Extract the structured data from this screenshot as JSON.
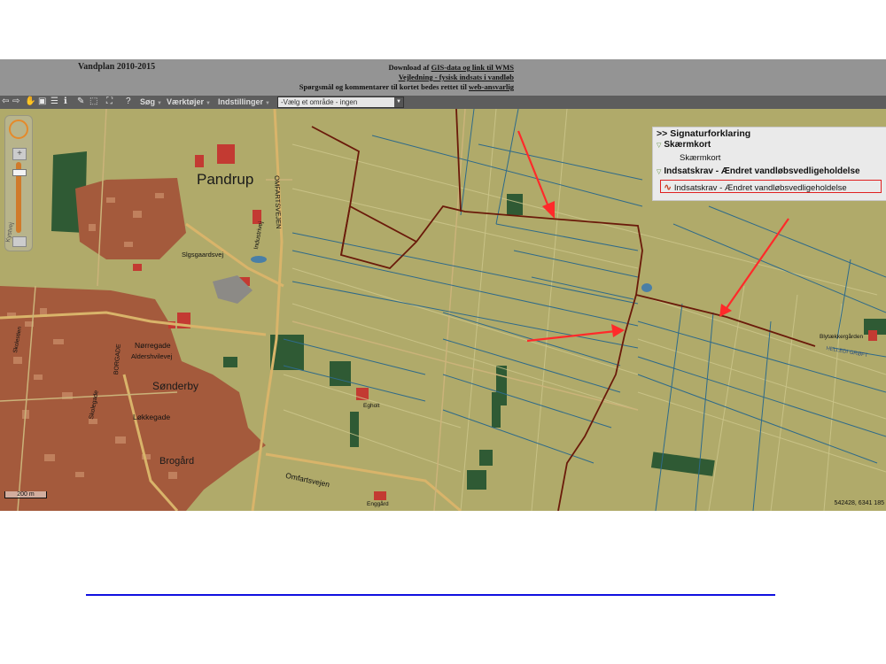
{
  "header": {
    "title": "Vandplan 2010-2015",
    "download_prefix": "Download af ",
    "download_link1": "GIS-data og link til WMS",
    "vejledning": "Vejledning - fysisk indsats i vandløb",
    "contact_prefix": "Spørgsmål og kommentarer til kortet bedes rettet til ",
    "contact_link": "web-ansvarlig"
  },
  "toolbar": {
    "menus": [
      {
        "label": "Søg"
      },
      {
        "label": "Værktøjer"
      },
      {
        "label": "Indstillinger"
      }
    ],
    "area_select_value": "-Vælg et område - ingen",
    "icons": [
      "back-icon",
      "forward-icon",
      "pan-hand-icon",
      "zoom-box-icon",
      "list-icon",
      "info-icon",
      "draw-icon",
      "select-icon",
      "measure-icon",
      "help-icon"
    ]
  },
  "legend": {
    "heading": "Signaturforklaring",
    "group1": "Skærmkort",
    "group1_item": "Skærmkort",
    "group2": "Indsatskrav - Ændret vandløbsvedligeholdelse",
    "group2_item": "Indsatskrav - Ændret vandløbsvedligeholdelse"
  },
  "map": {
    "town_main": "Pandrup",
    "town_2": "Sønderby",
    "town_3": "Brogård",
    "roads": {
      "omfartsvejen": "OMFARTSVEJEN",
      "omfartsvejen2": "Omfartsvejen",
      "norregade": "Nørregade",
      "aldershvilevej": "Aldershvilevej",
      "lokkegade": "Løkkegade",
      "slagsgaardsvej": "Slgsgaardsvej",
      "industrivej": "Industrivej",
      "borgade": "BORGADE",
      "skolegade": "Skolegade",
      "kystvej": "Kystvej",
      "egholt": "Egholt",
      "enggard": "Enggård",
      "blytaekkergarden": "Blytækkergården",
      "helledi": "HELLEDI GRØFT",
      "skolestien": "Skolestien"
    },
    "scale_label": "200 m",
    "coords": "542428, 6341 185"
  },
  "colors": {
    "map_base": "#b0aa6a",
    "urban": "#a85a3c",
    "watercourse": "#2e6a8a",
    "indsats_line": "#6a1a0a",
    "arrow": "#ff2a2a",
    "header_bg": "#949494",
    "toolbar_bg": "#5d5d5d"
  }
}
